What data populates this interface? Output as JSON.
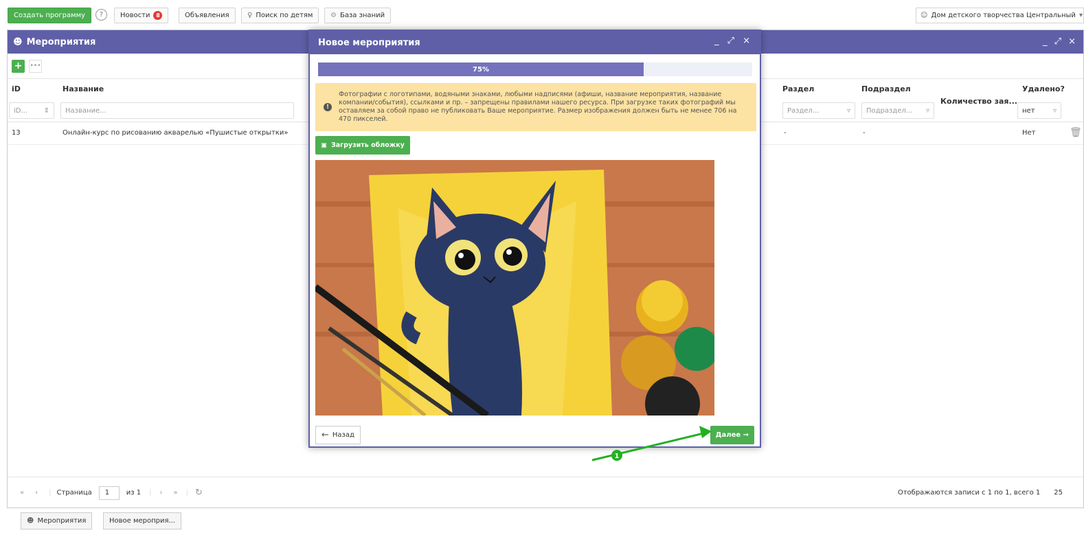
{
  "topbar": {
    "create_program": "Создать программу",
    "help": "?",
    "news": "Новости",
    "news_count": "8",
    "announcements": "Объявления",
    "search_children": "Поиск по детям",
    "knowledge_base": "База знаний",
    "user": "Дом детского творчества Центральный"
  },
  "main": {
    "title": "Мероприятия",
    "add": "+",
    "more": "•••",
    "columns": {
      "id": "iD",
      "name": "Название",
      "section": "Раздел",
      "subsection": "Подраздел",
      "requests": "Количество зая...",
      "deleted": "Удалено?"
    },
    "filters": {
      "id": "iD...",
      "name": "Название...",
      "section": "Раздел...",
      "subsection": "Подраздел...",
      "deleted": "нет"
    },
    "row": {
      "id": "13",
      "name": "Онлайн-курс по рисованию акварелью «Пушистые открытки»",
      "section": "-",
      "subsection": "-",
      "deleted": "Нет"
    },
    "pager": {
      "page_label": "Страница",
      "page": "1",
      "of": "из 1",
      "summary": "Отображаются записи с 1 по 1, всего 1",
      "page_size": "25"
    }
  },
  "taskbar": {
    "tab1": "Мероприятия",
    "tab2": "Новое мероприя..."
  },
  "modal": {
    "title": "Новое мероприятия",
    "progress_label": "75%",
    "progress": 0.75,
    "notice": "Фотографии с логотипами, водяными знаками, любыми надписями (афиши, название мероприятия, название компании/события), ссылками и пр. – запрещены правилами нашего ресурса. При загрузке таких фотографий мы оставляем за собой право не публиковать Ваше мероприятие. Размер изображения должен быть не менее 706 на 470 пикселей.",
    "upload": "Загрузить обложку",
    "back": "Назад",
    "next": "Далее →"
  },
  "annotation": {
    "marker": "1",
    "color": "#22b022"
  },
  "colors": {
    "header": "#5f5fa8",
    "green": "#4caf50",
    "notice": "#fce2a3"
  }
}
